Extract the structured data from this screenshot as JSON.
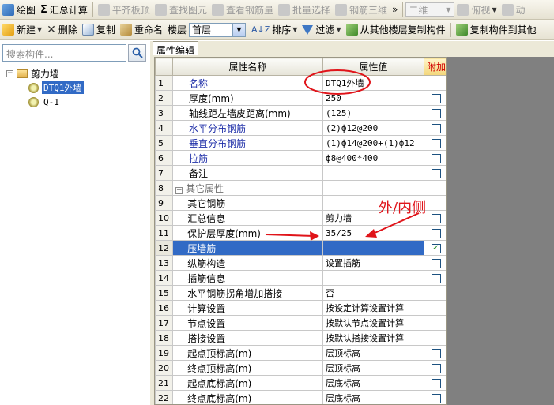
{
  "toolbar1": {
    "draw": "绘图",
    "sum_calc": "汇总计算",
    "align_top": "平齐板顶",
    "find_elem": "查找图元",
    "view_rebar": "查看钢筋量",
    "batch_select": "批量选择",
    "rebar_3d": "钢筋三维",
    "more": "»",
    "view_mode": "二维",
    "view_angle": "俯视",
    "dynamic": "动"
  },
  "toolbar2": {
    "new": "新建",
    "delete": "删除",
    "copy": "复制",
    "rename": "重命名",
    "floor_label": "楼层",
    "floor_value": "首层",
    "sort": "排序",
    "filter": "过滤",
    "copy_from_other_floor": "从其他楼层复制构件",
    "copy_to_other": "复制构件到其他"
  },
  "left_pane": {
    "search_placeholder": "搜索构件...",
    "tree": {
      "root": "剪力墙",
      "items": [
        "DTQ1外墙",
        "Q-1"
      ]
    }
  },
  "right_pane": {
    "tab": "属性编辑",
    "columns": [
      "属性名称",
      "属性值",
      "附加"
    ],
    "rows": [
      {
        "num": "1",
        "name": "名称",
        "value": "DTQ1外墙",
        "style": "blue",
        "check": "none"
      },
      {
        "num": "2",
        "name": "厚度(mm)",
        "value": "250",
        "style": "black",
        "check": "empty"
      },
      {
        "num": "3",
        "name": "轴线距左墙皮距离(mm)",
        "value": "(125)",
        "style": "black",
        "check": "empty"
      },
      {
        "num": "4",
        "name": "水平分布钢筋",
        "value": "(2)ф12@200",
        "style": "blue",
        "check": "empty"
      },
      {
        "num": "5",
        "name": "垂直分布钢筋",
        "value": "(1)ф14@200+(1)ф12",
        "style": "blue",
        "check": "empty"
      },
      {
        "num": "6",
        "name": "拉筋",
        "value": "ф8@400*400",
        "style": "blue",
        "check": "empty"
      },
      {
        "num": "7",
        "name": "备注",
        "value": "",
        "style": "black",
        "check": "empty"
      },
      {
        "num": "8",
        "name": "其它属性",
        "value": "",
        "style": "group",
        "check": "none"
      },
      {
        "num": "9",
        "name": "其它钢筋",
        "value": "",
        "style": "child",
        "check": "none"
      },
      {
        "num": "10",
        "name": "汇总信息",
        "value": "剪力墙",
        "style": "child",
        "check": "empty"
      },
      {
        "num": "11",
        "name": "保护层厚度(mm)",
        "value": "35/25",
        "style": "child",
        "check": "empty"
      },
      {
        "num": "12",
        "name": "压墙筋",
        "value": "",
        "style": "selected",
        "check": "checked"
      },
      {
        "num": "13",
        "name": "纵筋构造",
        "value": "设置插筋",
        "style": "child",
        "check": "empty"
      },
      {
        "num": "14",
        "name": "插筋信息",
        "value": "",
        "style": "child",
        "check": "empty"
      },
      {
        "num": "15",
        "name": "水平钢筋拐角增加搭接",
        "value": "否",
        "style": "child",
        "check": "none"
      },
      {
        "num": "16",
        "name": "计算设置",
        "value": "按设定计算设置计算",
        "style": "child",
        "check": "none"
      },
      {
        "num": "17",
        "name": "节点设置",
        "value": "按默认节点设置计算",
        "style": "child",
        "check": "none"
      },
      {
        "num": "18",
        "name": "搭接设置",
        "value": "按默认搭接设置计算",
        "style": "child",
        "check": "none"
      },
      {
        "num": "19",
        "name": "起点顶标高(m)",
        "value": "层顶标高",
        "style": "child",
        "check": "empty"
      },
      {
        "num": "20",
        "name": "终点顶标高(m)",
        "value": "层顶标高",
        "style": "child",
        "check": "empty"
      },
      {
        "num": "21",
        "name": "起点底标高(m)",
        "value": "层底标高",
        "style": "child",
        "check": "empty"
      },
      {
        "num": "22",
        "name": "终点底标高(m)",
        "value": "层底标高",
        "style": "child",
        "check": "empty"
      }
    ]
  },
  "annotation": {
    "text": "外/内侧",
    "color": "#e0141a"
  }
}
